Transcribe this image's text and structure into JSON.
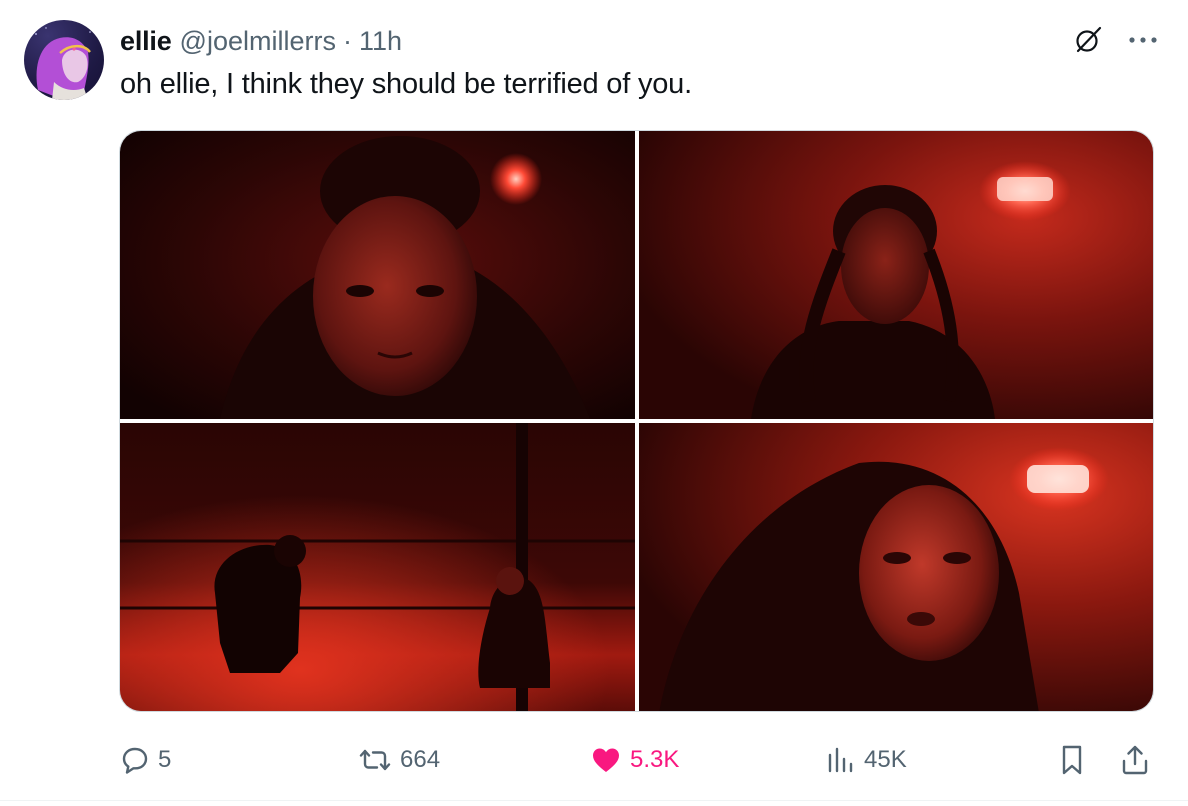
{
  "author": {
    "display_name": "ellie",
    "handle": "@joelmillerrs",
    "separator": "·",
    "time": "11h"
  },
  "tweet": {
    "text": "oh ellie, I think they should be terrified of you."
  },
  "media": {
    "count": 4
  },
  "actions": {
    "replies": "5",
    "reposts": "664",
    "likes": "5.3K",
    "views": "45K"
  },
  "colors": {
    "like_active": "#f91880",
    "secondary_text": "#536471",
    "primary_text": "#0f1419",
    "border": "#cfd9de"
  },
  "icons": [
    "grok-icon",
    "more-icon",
    "reply-icon",
    "repost-icon",
    "like-icon",
    "views-icon",
    "bookmark-icon",
    "share-icon"
  ]
}
